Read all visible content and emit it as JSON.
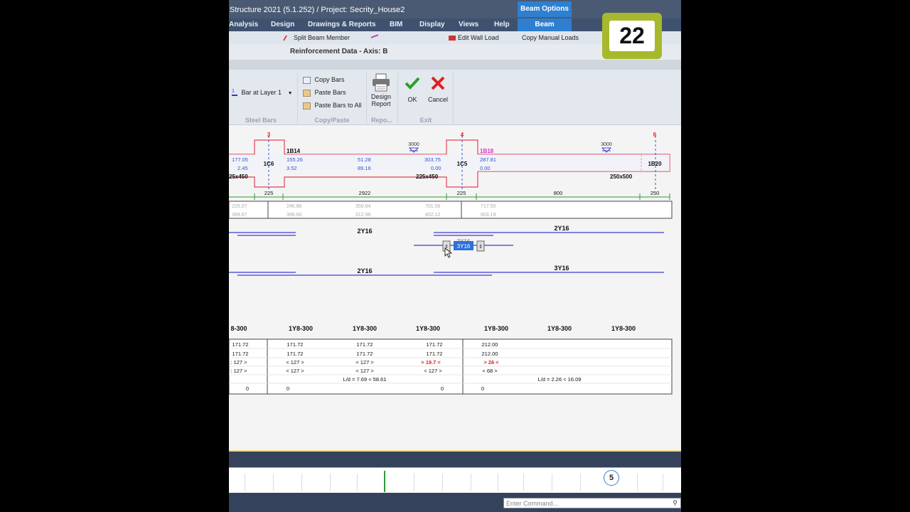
{
  "window": {
    "title": "Structure 2021 (5.1.252) / Project: Secrity_House2",
    "context_tab": "Beam Options"
  },
  "menu": {
    "items": [
      "Analysis",
      "Design",
      "Drawings & Reports",
      "BIM",
      "Display",
      "Views",
      "Help",
      "Beam"
    ],
    "active": "Beam"
  },
  "ribbon_strip": {
    "split_beam": "Split Beam Member",
    "edit_wall_load": "Edit Wall Load",
    "copy_manual_loads": "Copy Manual Loads"
  },
  "dialog": {
    "title": "Reinforcement Data - Axis: B",
    "steel_bars": {
      "bar_layer": "Bar at Layer 1",
      "label": "Steel Bars"
    },
    "copy_paste": {
      "copy": "Copy Bars",
      "paste": "Paste Bars",
      "paste_all": "Paste Bars to All",
      "label": "Copy/Paste"
    },
    "report": {
      "design_report_l1": "Design",
      "design_report_l2": "Report",
      "label": "Repo..."
    },
    "exit": {
      "ok": "OK",
      "cancel": "Cancel",
      "label": "Exit"
    }
  },
  "drawing": {
    "columns": [
      "3",
      "4",
      "6"
    ],
    "column_names": [
      "1C6",
      "1C5",
      "1B20"
    ],
    "beam_labels": [
      "1B14",
      "1B18"
    ],
    "loads": [
      "3000",
      "3000"
    ],
    "moments_row1": [
      "177.05",
      "155.26",
      "51.28",
      "303.75",
      "287.81"
    ],
    "moments_row2": [
      "2.45",
      "3.52",
      "89.16",
      "0.00",
      "0.00"
    ],
    "sections": [
      "25x450",
      "225x450",
      "250x500"
    ],
    "dims": [
      "225",
      "2922",
      "225",
      "800",
      "250"
    ],
    "steel_row1": [
      "225.07",
      "246.86",
      "350.84",
      "701.56",
      "717.50"
    ],
    "steel_row2": [
      "399.67",
      "398.60",
      "312.96",
      "402.12",
      "603.19"
    ],
    "top_bars": [
      "2Y16",
      "2Y16"
    ],
    "edit_box_ghost": "3Y16",
    "edit_box_value": "3Y16",
    "bottom_bars": [
      "2Y16",
      "3Y16"
    ],
    "stirrups": [
      "8-300",
      "1Y8-300",
      "1Y8-300",
      "1Y8-300",
      "1Y8-300",
      "1Y8-300",
      "1Y8-300"
    ],
    "shear_row1": [
      "171.72",
      "171.72",
      "171.72",
      "171.72",
      "212.00"
    ],
    "shear_row2": [
      "171.72",
      "171.72",
      "171.72",
      "171.72",
      "212.00"
    ],
    "check_row1": [
      ": 127 >",
      "< 127 >",
      "< 127 >",
      "> 19.7 <",
      "> 26 <"
    ],
    "check_row2": [
      ": 127 >",
      "< 127 >",
      "< 127 >",
      "< 127 >",
      "< 68 >"
    ],
    "deflection": [
      "L/d = 7.69 < 58.61",
      "L/d = 2.26 < 16.09"
    ],
    "zeros": [
      "0",
      "0",
      "0",
      "0"
    ]
  },
  "timeline": {
    "marker": "5"
  },
  "command": {
    "placeholder": "Enter Command..."
  },
  "step_badge": "22",
  "colors": {
    "beam_outline": "#e0405a",
    "dimension": "#2e9a3a",
    "bar_line": "#3a3ad8",
    "warning": "#e02020",
    "accent": "#2e7fd0"
  }
}
